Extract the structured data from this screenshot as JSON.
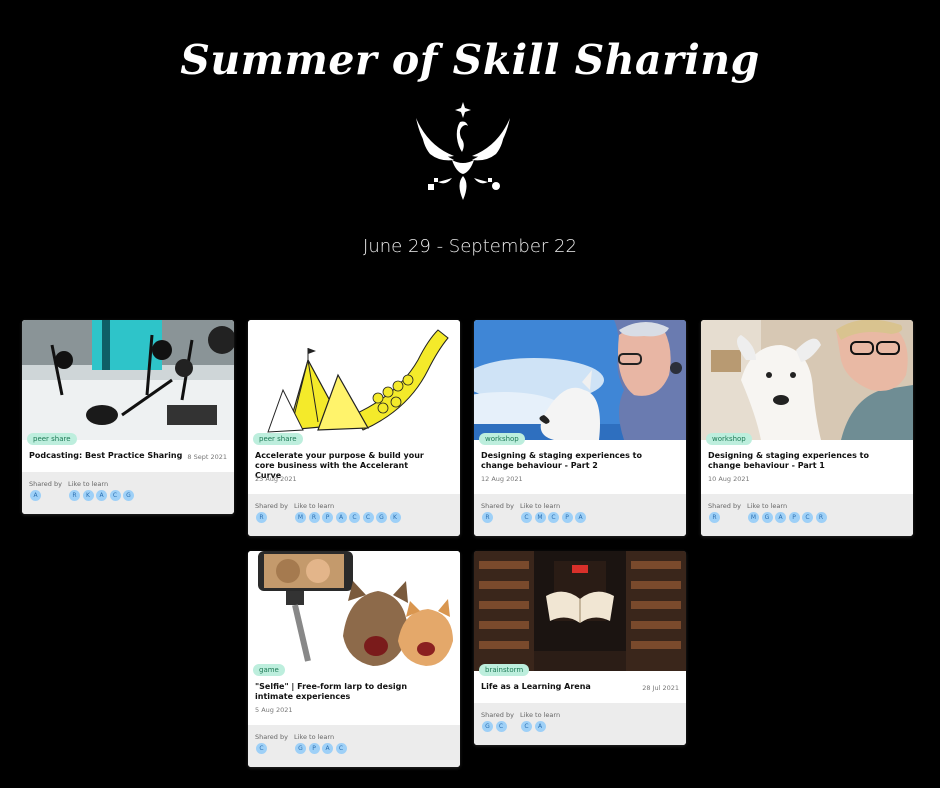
{
  "header": {
    "title": "Summer of Skill Sharing",
    "dates": "June 29 - September 22"
  },
  "labels": {
    "shared_by": "Shared by",
    "like_to_learn": "Like to learn"
  },
  "cards": [
    {
      "tag": "peer share",
      "title": "Podcasting: Best Practice Sharing",
      "date": "8 Sept 2021",
      "shared_by": [
        "A"
      ],
      "like_to_learn": [
        "R",
        "K",
        "A",
        "C",
        "G"
      ]
    },
    {
      "tag": "peer share",
      "title": "Accelerate your purpose & build your core business with the Accelerant Curve",
      "date": "23 Aug 2021",
      "shared_by": [
        "R"
      ],
      "like_to_learn": [
        "M",
        "R",
        "P",
        "A",
        "C",
        "C",
        "G",
        "K"
      ]
    },
    {
      "tag": "workshop",
      "title": "Designing & staging experiences to change behaviour - Part 2",
      "date": "12 Aug 2021",
      "shared_by": [
        "R"
      ],
      "like_to_learn": [
        "C",
        "M",
        "C",
        "P",
        "A"
      ]
    },
    {
      "tag": "workshop",
      "title": "Designing & staging experiences to change behaviour - Part 1",
      "date": "10 Aug 2021",
      "shared_by": [
        "R"
      ],
      "like_to_learn": [
        "M",
        "G",
        "A",
        "P",
        "C",
        "R"
      ]
    },
    {
      "tag": "game",
      "title": "\"Selfie\" | Free-form larp to design intimate experiences",
      "date": "5 Aug 2021",
      "shared_by": [
        "C"
      ],
      "like_to_learn": [
        "G",
        "P",
        "A",
        "C"
      ]
    },
    {
      "tag": "brainstorm",
      "title": "Life as a Learning Arena",
      "date": "28 Jul 2021",
      "shared_by": [
        "G",
        "C"
      ],
      "like_to_learn": [
        "C",
        "A"
      ]
    }
  ],
  "colors": {
    "background": "#000000",
    "tag_bg": "#bdeedd",
    "tag_text": "#1e7a56",
    "avatar_bg": "#9ed0f7",
    "avatar_text": "#2b6fb0",
    "footer_bg": "#ececec"
  }
}
